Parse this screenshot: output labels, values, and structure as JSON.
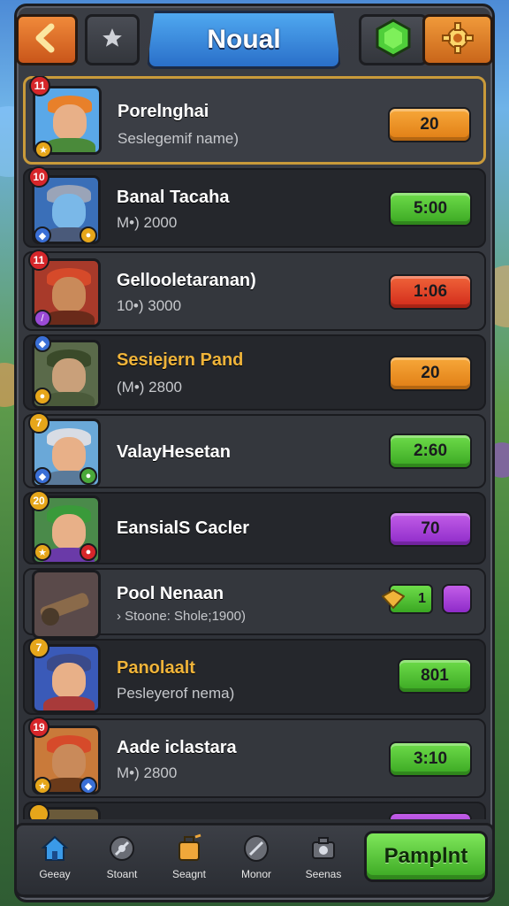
{
  "header": {
    "title": "Noual",
    "back_icon": "chevron-left-icon",
    "fav_icon": "star-icon",
    "gem_icon": "gem-icon",
    "settings_icon": "gear-icon"
  },
  "list": [
    {
      "level": "11",
      "name": "Porelnghai",
      "sub": "Seslegemif name)",
      "value": "20",
      "color": "orange",
      "highlight": true
    },
    {
      "level": "10",
      "name": "Banal Tacaha",
      "sub": "M•) 2000",
      "value": "5:00",
      "color": "green"
    },
    {
      "level": "11",
      "name": "Gellooletaranan)",
      "sub": "10•) 3000",
      "value": "1:06",
      "color": "red"
    },
    {
      "level": "",
      "name": "Sesiejern Pand",
      "sub": "(M•) 2800",
      "value": "20",
      "color": "orange",
      "gold_name": true
    },
    {
      "level": "7",
      "name": "ValayHesetan",
      "sub": "",
      "value": "2:60",
      "color": "green"
    },
    {
      "level": "20",
      "name": "EansialS Cacler",
      "sub": "",
      "value": "70",
      "color": "purple"
    },
    {
      "level": "",
      "name": "Pool Nenaan",
      "sub": "› Stoone: Shole;1900)",
      "value": "1",
      "color": "green"
    },
    {
      "level": "7",
      "name": "Panolaalt",
      "sub": "Pesleyerof nema)",
      "value": "801",
      "color": "green",
      "gold_name": true
    },
    {
      "level": "19",
      "name": "Aade iclastara",
      "sub": "M•) 2800",
      "value": "3:10",
      "color": "green"
    }
  ],
  "nav": [
    {
      "label": "Geeay",
      "icon": "home-icon"
    },
    {
      "label": "Stoant",
      "icon": "compass-icon"
    },
    {
      "label": "Seagnt",
      "icon": "quest-icon"
    },
    {
      "label": "Monor",
      "icon": "shield-icon"
    },
    {
      "label": "Seenas",
      "icon": "camera-icon"
    }
  ],
  "cta_label": "Pamplnt",
  "colors": {
    "panel": "#2c2f35",
    "accent_blue": "#2a6fc9",
    "accent_orange": "#e07d14",
    "accent_green": "#3aa722",
    "accent_purple": "#8e2bc9",
    "accent_red": "#d12a1a",
    "gold": "#f0b43a"
  }
}
